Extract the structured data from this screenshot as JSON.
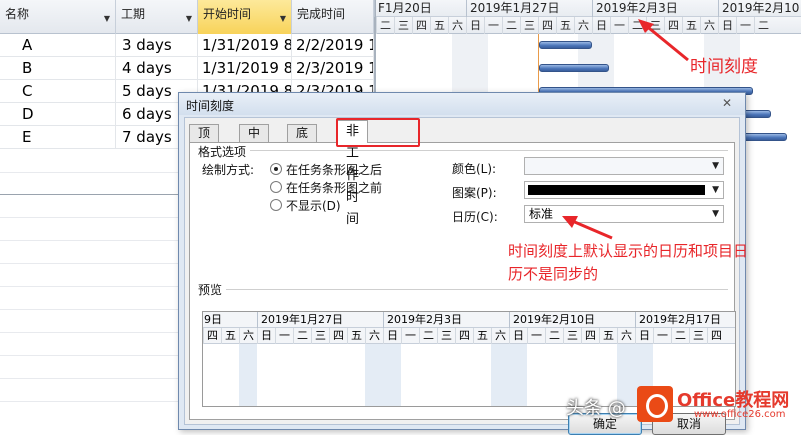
{
  "table": {
    "columns": [
      "名称",
      "工期",
      "开始时间",
      "完成时间"
    ],
    "rows": [
      {
        "name": "A",
        "duration": "3 days",
        "start": "1/31/2019 8",
        "finish": "2/2/2019 1"
      },
      {
        "name": "B",
        "duration": "4 days",
        "start": "1/31/2019 8",
        "finish": "2/3/2019 1"
      },
      {
        "name": "C",
        "duration": "5 days",
        "start": "1/31/2019 8",
        "finish": "2/3/2019 1"
      },
      {
        "name": "D",
        "duration": "6 days",
        "start": "",
        "finish": ""
      },
      {
        "name": "E",
        "duration": "7 days",
        "start": "",
        "finish": ""
      }
    ]
  },
  "gantt": {
    "weeks": [
      "F1月20日",
      "2019年1月27日",
      "2019年2月3日",
      "2019年2月10日"
    ],
    "days": [
      "二",
      "三",
      "四",
      "五",
      "六",
      "日",
      "一",
      "二",
      "三",
      "四",
      "五",
      "六",
      "日",
      "一",
      "二",
      "三",
      "四",
      "五",
      "六",
      "日",
      "一",
      "二"
    ]
  },
  "annotations": {
    "top": "时间刻度",
    "middle": "时间刻度上默认显示的日历和项目日历不是同步的"
  },
  "dialog": {
    "title": "时间刻度",
    "close_label": "✕",
    "tabs": [
      "顶层",
      "中层",
      "底层",
      "非工作时间"
    ],
    "section_format": "格式选项",
    "draw_label": "绘制方式:",
    "radio_options": [
      "在任务条形图之后",
      "在任务条形图之前",
      "不显示(D)"
    ],
    "color_label": "颜色(L):",
    "pattern_label": "图案(P):",
    "calendar_label": "日历(C):",
    "calendar_value": "标准",
    "preview_label": "预览",
    "preview_weeks": [
      "9日",
      "2019年1月27日",
      "2019年2月3日",
      "2019年2月10日",
      "2019年2月17日"
    ],
    "preview_days": [
      "四",
      "五",
      "六",
      "日",
      "一",
      "二",
      "三",
      "四",
      "五",
      "六",
      "日",
      "一",
      "二",
      "三",
      "四",
      "五",
      "六",
      "日",
      "一",
      "二",
      "三",
      "四",
      "五",
      "六",
      "日",
      "一",
      "二",
      "三",
      "四"
    ],
    "ok_label": "确定",
    "cancel_label": "取消"
  },
  "watermark": {
    "text": "头条 @",
    "brand": "Office教程网",
    "url": "www.office26.com"
  },
  "colors": {
    "annotation": "#e8262a",
    "bar": "#4a74b8",
    "header_highlight": "#f8d35a"
  }
}
